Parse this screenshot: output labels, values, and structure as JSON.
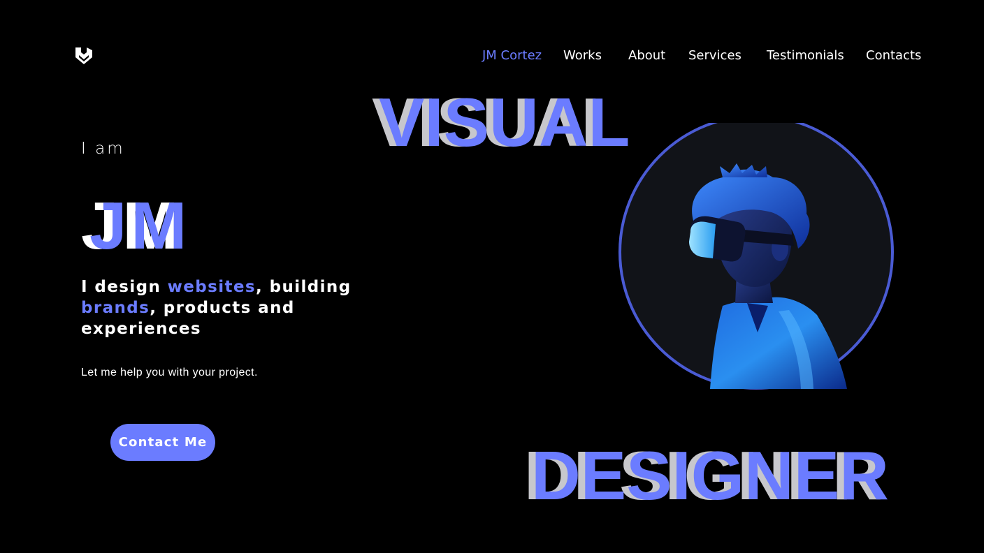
{
  "header": {
    "logo_icon": "shield-chevron-logo",
    "nav": [
      {
        "label": "JM Cortez",
        "active": true
      },
      {
        "label": "Works",
        "active": false
      },
      {
        "label": "About",
        "active": false
      },
      {
        "label": "Services",
        "active": false
      },
      {
        "label": "Testimonials",
        "active": false
      },
      {
        "label": "Contacts",
        "active": false
      }
    ]
  },
  "hero": {
    "intro": "I am",
    "name": "JM",
    "tagline": {
      "part1": "I design ",
      "accent1": "websites",
      "part2": ", building ",
      "accent2": "brands",
      "part3": ", products and experiences"
    },
    "subline": "Let me help you with your project.",
    "cta_label": "Contact Me"
  },
  "big_words": {
    "top": "VISUAL",
    "bottom": "DESIGNER"
  },
  "portrait": {
    "subject": "person-with-vr-headset-illustration"
  },
  "colors": {
    "background": "#000000",
    "accent": "#6b7cff",
    "text": "#ffffff",
    "shadow_text": "#c7c7cc",
    "circle_fill": "#111318",
    "circle_stroke": "#4a5bd4"
  }
}
